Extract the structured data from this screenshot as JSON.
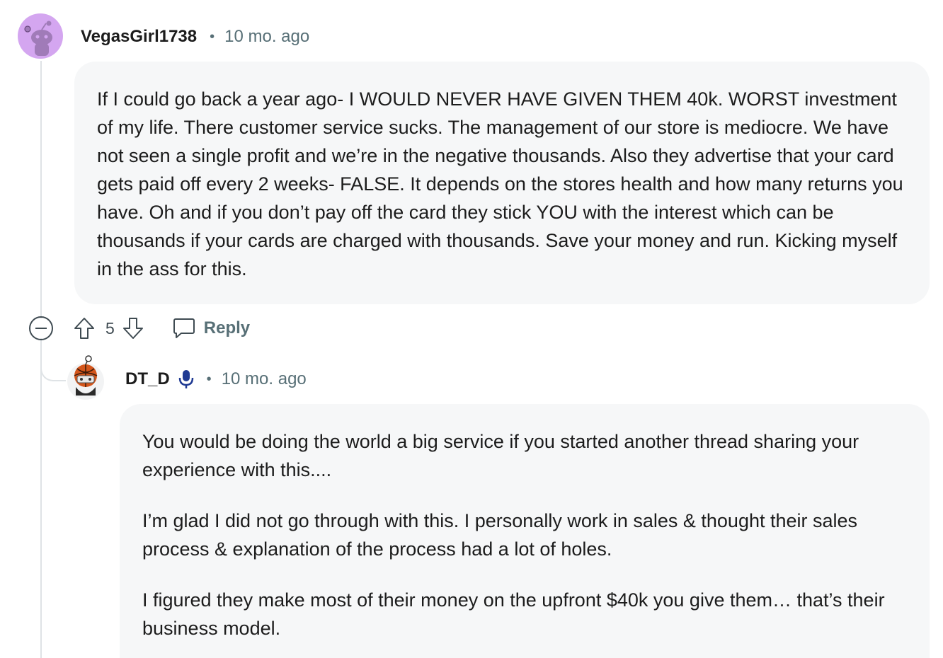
{
  "comments": [
    {
      "username": "VegasGirl1738",
      "separator": "•",
      "time": "10 mo. ago",
      "avatar_icon": "snoo-avatar-purple-icon",
      "paragraphs": [
        "If I could go back a year ago- I WOULD NEVER HAVE GIVEN THEM 40k. WORST investment of my life. There customer service sucks. The management of our store is mediocre. We have not seen a single profit and we’re in the negative thousands. Also they advertise that your card gets paid off every 2 weeks- FALSE. It depends on the stores health and how many returns you have. Oh and if you don’t pay off the card they stick YOU with the interest which can be thousands if your cards are charged with thousands. Save your money and run. Kicking myself in the ass for this."
      ],
      "actions": {
        "score": "5",
        "reply_label": "Reply"
      }
    },
    {
      "username": "DT_D",
      "separator": "•",
      "time": "10 mo. ago",
      "avatar_icon": "snoo-avatar-basketball-icon",
      "badge_icon": "microphone-icon",
      "paragraphs": [
        "You would be doing the world a big service if you started another thread sharing your experience with this....",
        "I’m glad I did not go through with this. I personally work in sales & thought their sales process & explanation of the process had a lot of holes.",
        "I figured they make most of their money on the upfront $40k you give them… that’s their business model."
      ]
    }
  ],
  "colors": {
    "bubble_background": "#f6f7f8",
    "meta_text": "#576f76",
    "thread_line": "#dfe3e6",
    "avatar_purple": "#d4a6f0",
    "mic_blue": "#1f3a93"
  }
}
